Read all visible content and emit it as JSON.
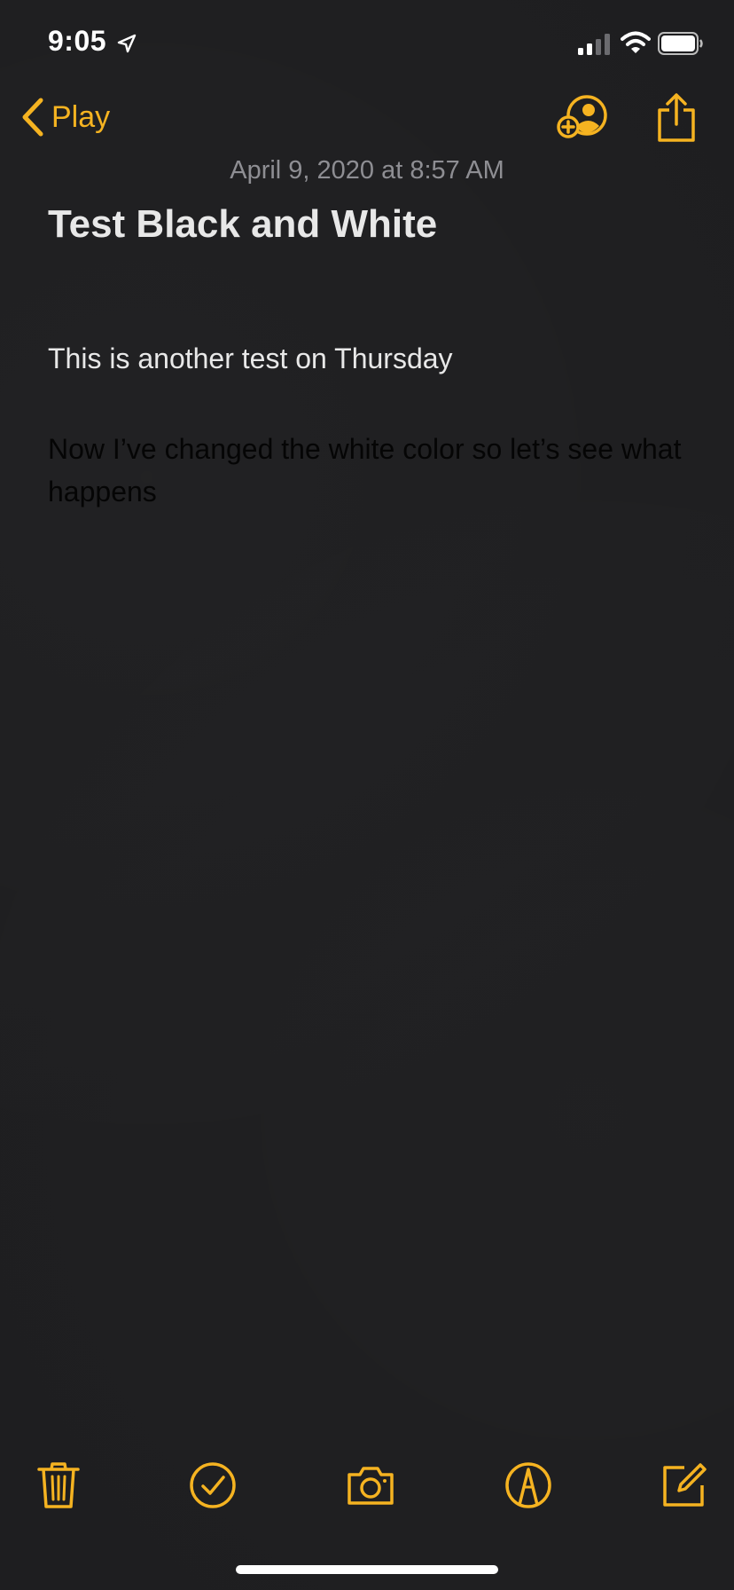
{
  "status_bar": {
    "time": "9:05",
    "icons": [
      "location-arrow-icon",
      "cellular-signal-icon",
      "wifi-icon",
      "battery-icon"
    ]
  },
  "nav": {
    "back_label": "Play",
    "icons": [
      "chevron-left-icon",
      "add-person-icon",
      "share-icon"
    ]
  },
  "note": {
    "date": "April 9, 2020 at 8:57 AM",
    "title": "Test Black and White",
    "line1": "This is another test on Thursday",
    "line2": "Now I’ve changed the white color so let’s see what happens"
  },
  "toolbar": {
    "icons": [
      "trash-icon",
      "checklist-icon",
      "camera-icon",
      "markup-icon",
      "compose-icon"
    ]
  },
  "colors": {
    "accent": "#f5b321",
    "background": "#1e1e20",
    "text": "#e8e8e8",
    "date_text": "#8e8e93",
    "hidden_text": "#050505"
  }
}
